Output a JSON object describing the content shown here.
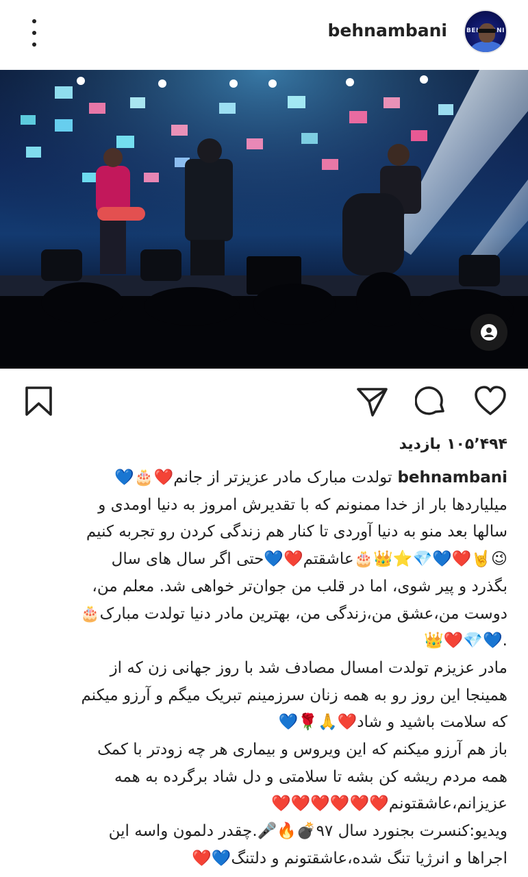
{
  "header": {
    "username": "behnambani",
    "avatar_text": "BEHNAM BANI"
  },
  "media": {
    "description_icon": "user-tag-icon"
  },
  "actions": {
    "icons": [
      "heart-icon",
      "comment-icon",
      "share-icon",
      "bookmark-icon"
    ]
  },
  "stats": {
    "views_count": "۱۰۵٬۴۹۴",
    "views_label": "بازدید"
  },
  "caption": {
    "username": "behnambani",
    "lines": [
      "تولدت مبارک مادر عزیزتر از جانم❤️🎂💙",
      "میلیاردها بار از خدا ممنونم که با تقدیرش امروز به دنیا اومدی و",
      "سالها بعد منو به دنیا آوردی تا کنار هم زندگی کردن رو تجربه کنیم",
      "😉🤘❤️💙💎⭐️👑🎂عاشقتم❤️💙حتی اگر سال های سال",
      "بگذرد و پیر شوی، اما در قلب من جوان‌تر خواهی شد. معلم من،",
      "دوست من،عشق من،زندگی من، بهترین مادر دنیا تولدت مبارک🎂",
      ".💙💎❤️👑",
      "مادر عزیزم تولدت امسال مصادف شد با روز جهانی زن که از",
      "همینجا این روز رو به همه زنان سرزمینم تبریک میگم و آرزو میکنم",
      "که سلامت باشید و شاد❤️🙏🌹💙",
      "باز هم آرزو میکنم که این ویروس و بیماری هر چه زودتر با کمک",
      "همه مردم ریشه کن بشه تا سلامتی و دل شاد برگرده به همه",
      "عزیزانم،عاشقتونم❤️❤️❤️❤️❤️❤️",
      "ویدیو:کنسرت بجنورد سال ۹۷💣🔥🎤.چقدر دلمون واسه این",
      "اجراها و انرژیا تنگ شده،عاشقتونم و دلتنگ💙❤️"
    ]
  },
  "colors": {
    "text": "#222222",
    "background": "#ffffff"
  }
}
